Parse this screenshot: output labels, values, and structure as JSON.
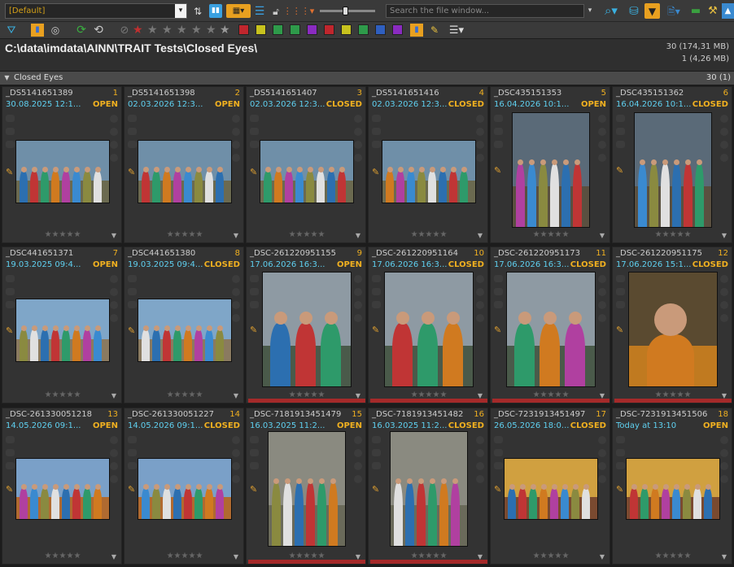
{
  "toolbar": {
    "preset": "[Default]",
    "search_placeholder": "Search the file window..."
  },
  "colors": {
    "swatches": [
      "#c0262d",
      "#c8c21e",
      "#2e9a4a",
      "#2e9a4a",
      "#8a2bc0",
      "#c0262d",
      "#c8c21e",
      "#2e9a4a",
      "#2f5fbf",
      "#8a2bc0"
    ],
    "accent": "#f0b020",
    "date": "#5fd0f0"
  },
  "location": {
    "path": "C:\\data\\imdata\\AINN\\TRAIT Tests\\Closed Eyes\\",
    "count_all": "30 (174,31 MB)",
    "count_sel": "1 (4,26 MB)"
  },
  "group": {
    "name": "Closed Eyes",
    "count": "30 (1)"
  },
  "files": [
    {
      "name": "_DS5141651389",
      "num": "1",
      "date": "30.08.2025 12:1...",
      "status": "OPEN",
      "theme": "group"
    },
    {
      "name": "_DS5141651398",
      "num": "2",
      "date": "02.03.2026 12:3...",
      "status": "OPEN",
      "theme": "group"
    },
    {
      "name": "_DS5141651407",
      "num": "3",
      "date": "02.03.2026 12:3...",
      "status": "CLOSED",
      "theme": "group"
    },
    {
      "name": "_DS5141651416",
      "num": "4",
      "date": "02.03.2026 12:3...",
      "status": "CLOSED",
      "theme": "group"
    },
    {
      "name": "_DSC435151353",
      "num": "5",
      "date": "16.04.2026 10:1...",
      "status": "OPEN",
      "theme": "tall"
    },
    {
      "name": "_DSC435151362",
      "num": "6",
      "date": "16.04.2026 10:1...",
      "status": "CLOSED",
      "theme": "tall"
    },
    {
      "name": "_DSC441651371",
      "num": "7",
      "date": "19.03.2025 09:4...",
      "status": "OPEN",
      "theme": "group2"
    },
    {
      "name": "_DSC441651380",
      "num": "8",
      "date": "19.03.2025 09:4...",
      "status": "CLOSED",
      "theme": "group2"
    },
    {
      "name": "_DSC-261220951155",
      "num": "9",
      "date": "17.06.2026 16:3...",
      "status": "OPEN",
      "theme": "trio"
    },
    {
      "name": "_DSC-261220951164",
      "num": "10",
      "date": "17.06.2026 16:3...",
      "status": "CLOSED",
      "theme": "trio"
    },
    {
      "name": "_DSC-261220951173",
      "num": "11",
      "date": "17.06.2026 16:3...",
      "status": "CLOSED",
      "theme": "trio"
    },
    {
      "name": "_DSC-261220951175",
      "num": "12",
      "date": "17.06.2026 15:1...",
      "status": "CLOSED",
      "theme": "portrait"
    },
    {
      "name": "_DSC-261330051218",
      "num": "13",
      "date": "14.05.2026 09:1...",
      "status": "OPEN",
      "theme": "mountain"
    },
    {
      "name": "_DSC-261330051227",
      "num": "14",
      "date": "14.05.2026 09:1...",
      "status": "CLOSED",
      "theme": "mountain"
    },
    {
      "name": "_DSC-7181913451479",
      "num": "15",
      "date": "16.03.2025 11:2...",
      "status": "OPEN",
      "theme": "crowd"
    },
    {
      "name": "_DSC-7181913451482",
      "num": "16",
      "date": "16.03.2025 11:2...",
      "status": "CLOSED",
      "theme": "crowd"
    },
    {
      "name": "_DSC-7231913451497",
      "num": "17",
      "date": "26.05.2026 18:0...",
      "status": "CLOSED",
      "theme": "sunset"
    },
    {
      "name": "_DSC-7231913451506",
      "num": "18",
      "date": "Today at 13:10",
      "status": "OPEN",
      "theme": "sunset"
    }
  ]
}
